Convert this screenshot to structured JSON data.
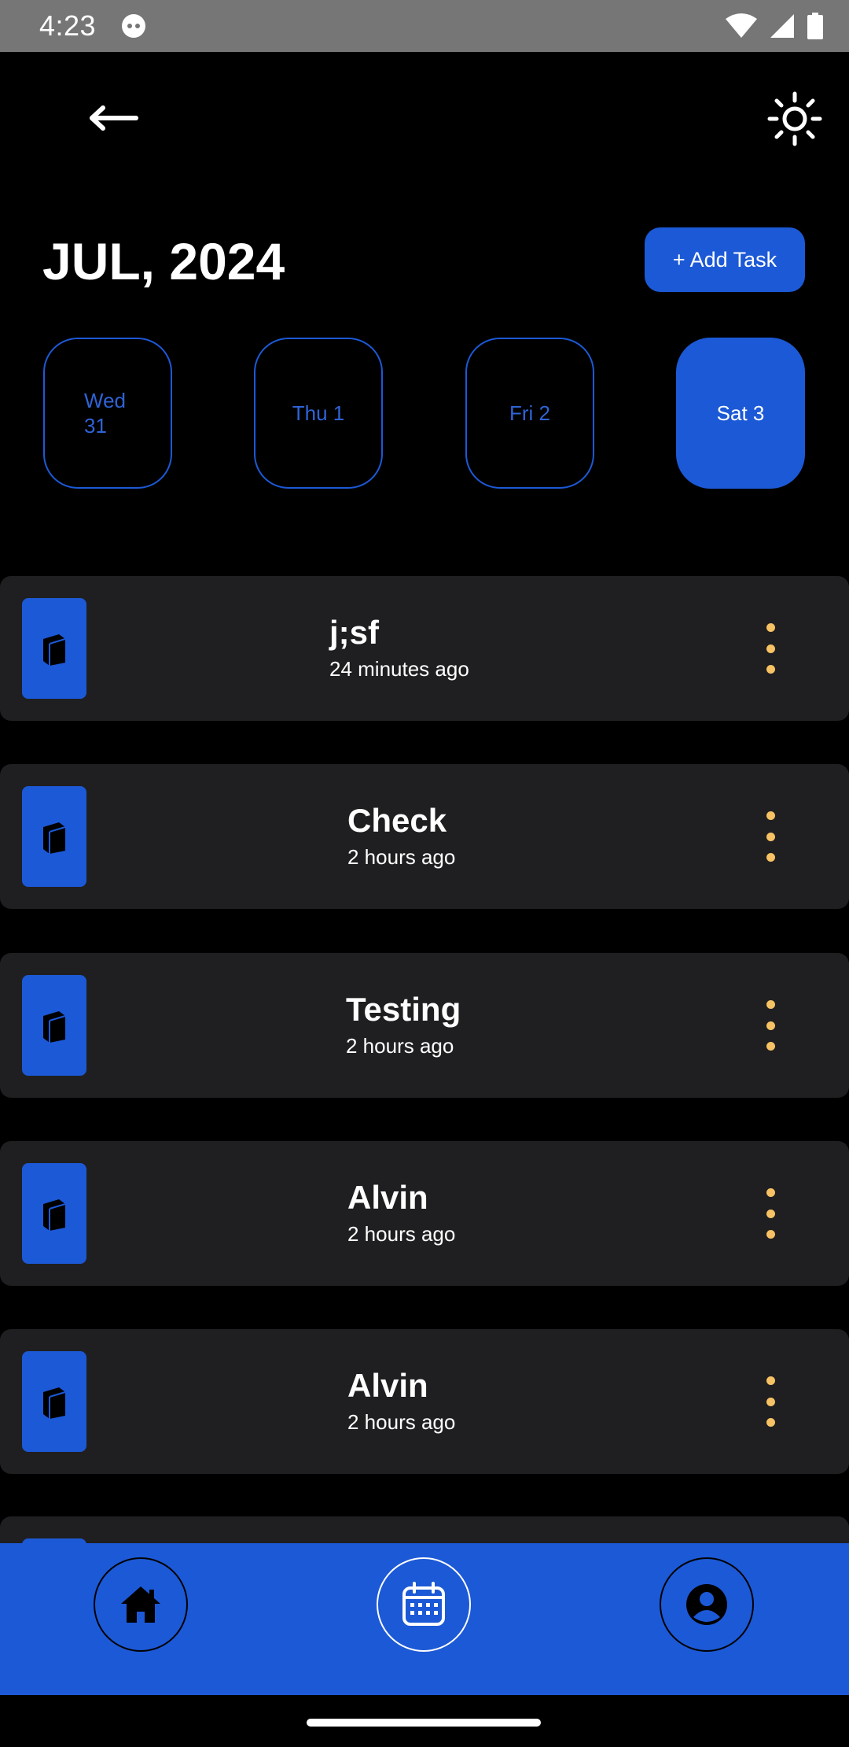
{
  "status_bar": {
    "time": "4:23"
  },
  "header": {
    "back_icon": "arrow-left-icon",
    "theme_icon": "sun-icon",
    "month_title": "JUL, 2024",
    "add_task_label": "+ Add Task"
  },
  "dates": [
    {
      "label": "Wed\n31",
      "selected": false
    },
    {
      "label": "Thu 1",
      "selected": false
    },
    {
      "label": "Fri 2",
      "selected": false
    },
    {
      "label": "Sat 3",
      "selected": true
    }
  ],
  "tasks": [
    {
      "title": "j;sf",
      "time": "24 minutes ago"
    },
    {
      "title": "Check",
      "time": "2 hours ago"
    },
    {
      "title": "Testing",
      "time": "2 hours ago"
    },
    {
      "title": "Alvin",
      "time": "2 hours ago"
    },
    {
      "title": "Alvin",
      "time": "2 hours ago"
    }
  ],
  "bottom_nav": {
    "items": [
      {
        "icon": "home-icon",
        "active": false
      },
      {
        "icon": "calendar-icon",
        "active": true
      },
      {
        "icon": "profile-icon",
        "active": false
      }
    ]
  },
  "colors": {
    "accent": "#1c59d6",
    "card": "#1f1f21",
    "menu_dots": "#f6c264",
    "background": "#000000"
  }
}
